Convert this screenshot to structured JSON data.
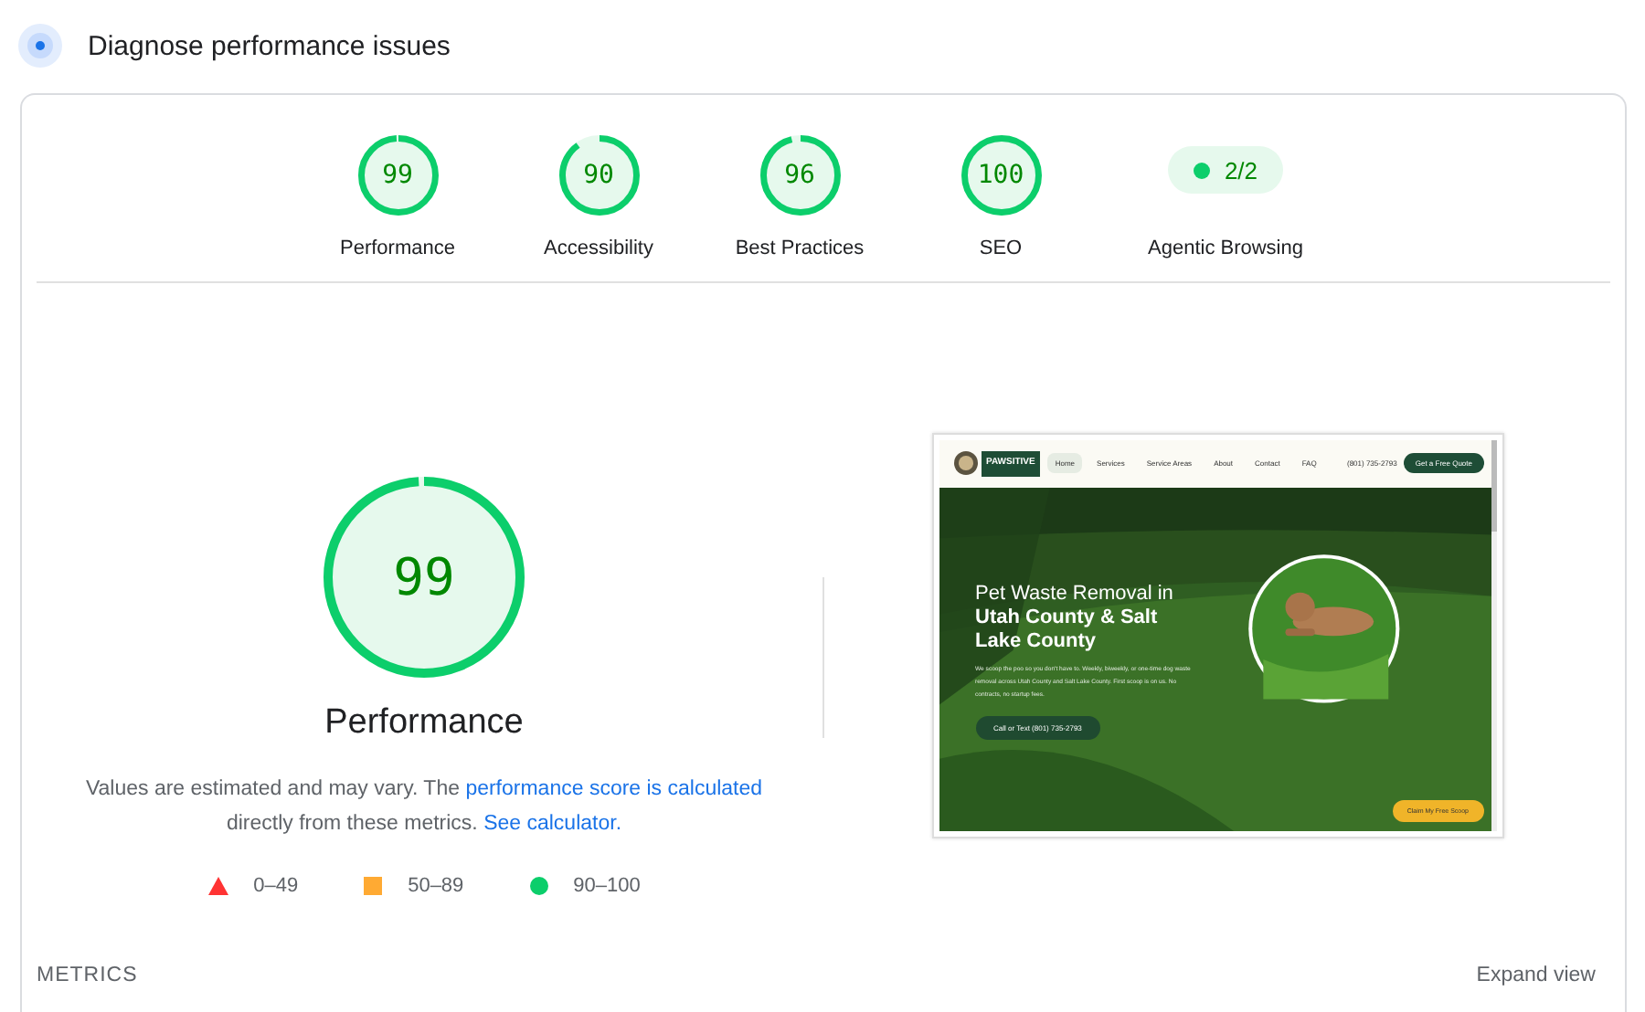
{
  "header": {
    "title": "Diagnose performance issues"
  },
  "categories": [
    {
      "score": "99",
      "label": "Performance",
      "level": 0.99
    },
    {
      "score": "90",
      "label": "Accessibility",
      "level": 0.9
    },
    {
      "score": "96",
      "label": "Best Practices",
      "level": 0.96
    },
    {
      "score": "100",
      "label": "SEO",
      "level": 1
    }
  ],
  "agentic": {
    "value": "2/2",
    "label": "Agentic Browsing"
  },
  "performance": {
    "score": "99",
    "level": 0.99,
    "title": "Performance",
    "text_before": "Values are estimated and may vary. The ",
    "link": "performance score is calculated",
    "text_after": " directly from these metrics. ",
    "link2": "See calculator."
  },
  "legend": [
    {
      "kind": "triangle",
      "range": "0–49",
      "color": "#ff3333"
    },
    {
      "kind": "square",
      "range": "50–89",
      "color": "#ffaa33"
    },
    {
      "kind": "circle",
      "range": "90–100",
      "color": "#0cce6b"
    }
  ],
  "thumbnail": {
    "brand": "PAWSITIVE",
    "nav": [
      {
        "label": "Home",
        "selected": true
      },
      {
        "label": "Services",
        "selected": false
      },
      {
        "label": "Service Areas",
        "selected": false
      },
      {
        "label": "About",
        "selected": false
      },
      {
        "label": "Contact",
        "selected": false
      },
      {
        "label": "FAQ",
        "selected": false
      }
    ],
    "phone": "(801) 735-2793",
    "quote_button": "Get a Free Quote",
    "headline": "Pet Waste Removal in",
    "headline_bold": "Utah County & Salt Lake County",
    "paragraph": "We scoop the poo so you don't have to. Weekly, biweekly, or one-time dog waste removal across Utah County and Salt Lake County. First scoop is on us. No contracts, no startup fees.",
    "call_button": "Call or Text (801) 735-2793",
    "claim_button": "Claim My Free Scoop"
  },
  "metrics": {
    "title": "METRICS",
    "expand": "Expand view"
  }
}
